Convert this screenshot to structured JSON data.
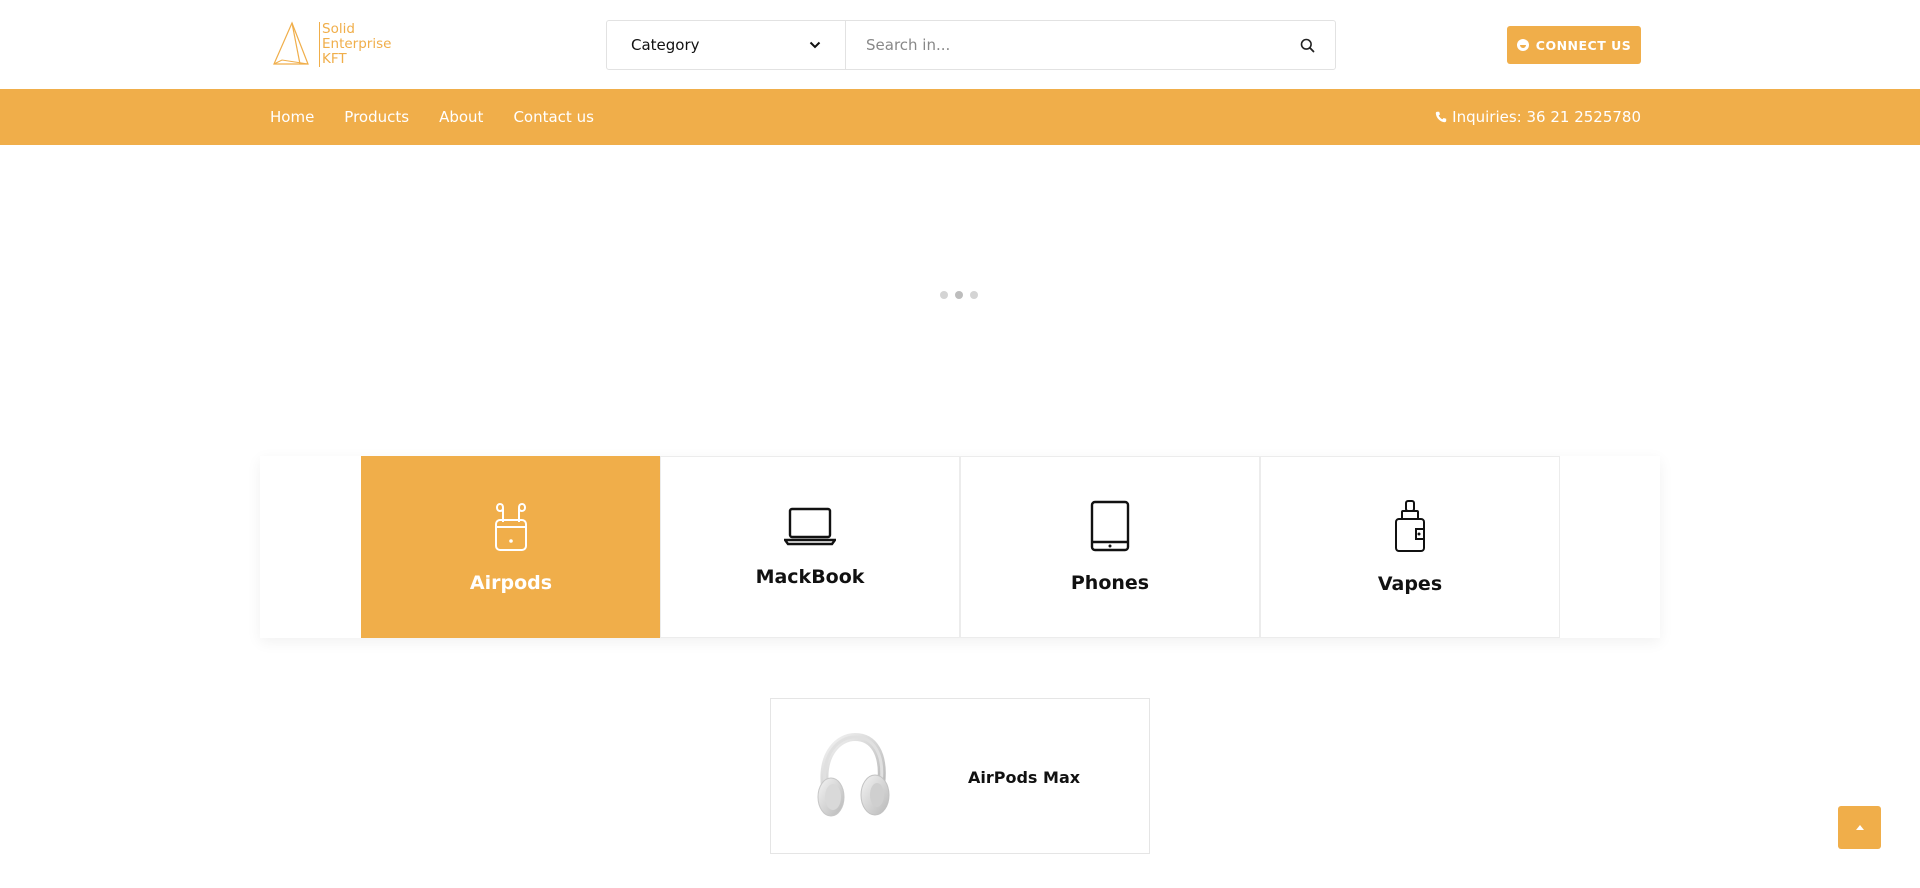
{
  "header": {
    "logo": {
      "line1": "Solid",
      "line2": "Enterprise",
      "line3": "KFT",
      "icon": "pyramid-logo-icon"
    },
    "search": {
      "category_label": "Category",
      "category_icon": "chevron-down-icon",
      "placeholder": "Search in...",
      "value": "",
      "search_icon": "search-icon"
    },
    "connect_label": "CONNECT US",
    "connect_icon": "smile-icon"
  },
  "nav": {
    "items": [
      {
        "label": "Home"
      },
      {
        "label": "Products"
      },
      {
        "label": "About"
      },
      {
        "label": "Contact us"
      }
    ],
    "phone_icon": "phone-icon",
    "inquiries": "Inquiries: 36 21 2525780"
  },
  "categories": [
    {
      "label": "Airpods",
      "icon": "airpods-icon",
      "active": true
    },
    {
      "label": "MackBook",
      "icon": "laptop-icon",
      "active": false
    },
    {
      "label": "Phones",
      "icon": "tablet-icon",
      "active": false
    },
    {
      "label": "Vapes",
      "icon": "vape-icon",
      "active": false
    }
  ],
  "products": [
    {
      "name": "AirPods Max",
      "image": "headphones-image"
    }
  ],
  "colors": {
    "accent": "#f0ae4a",
    "text": "#111111",
    "border": "#e5e5e5"
  },
  "scroll_top_icon": "chevron-up-icon"
}
